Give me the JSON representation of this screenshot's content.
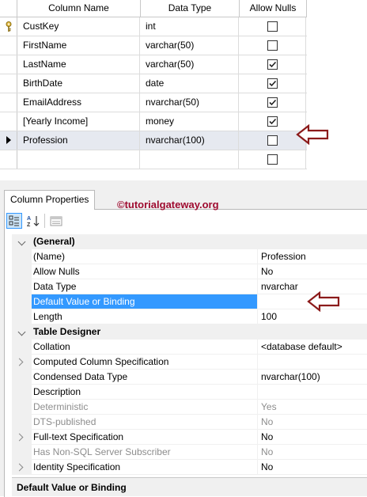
{
  "grid": {
    "headers": {
      "column_name": "Column Name",
      "data_type": "Data Type",
      "allow_nulls": "Allow Nulls"
    },
    "rows": [
      {
        "name": "CustKey",
        "type": "int",
        "allow_nulls": false,
        "primary_key": true,
        "current": false
      },
      {
        "name": "FirstName",
        "type": "varchar(50)",
        "allow_nulls": false,
        "primary_key": false,
        "current": false
      },
      {
        "name": "LastName",
        "type": "varchar(50)",
        "allow_nulls": true,
        "primary_key": false,
        "current": false
      },
      {
        "name": "BirthDate",
        "type": "date",
        "allow_nulls": true,
        "primary_key": false,
        "current": false
      },
      {
        "name": "EmailAddress",
        "type": "nvarchar(50)",
        "allow_nulls": true,
        "primary_key": false,
        "current": false
      },
      {
        "name": "[Yearly Income]",
        "type": "money",
        "allow_nulls": true,
        "primary_key": false,
        "current": false
      },
      {
        "name": "Profession",
        "type": "nvarchar(100)",
        "allow_nulls": false,
        "primary_key": false,
        "current": true
      },
      {
        "name": "",
        "type": "",
        "allow_nulls": false,
        "primary_key": false,
        "current": false
      }
    ]
  },
  "panel": {
    "tab_label": "Column Properties",
    "watermark": "©tutorialgateway.org"
  },
  "properties": {
    "general": {
      "label": "(General)",
      "name_label": "(Name)",
      "name_value": "Profession",
      "allow_nulls_label": "Allow Nulls",
      "allow_nulls_value": "No",
      "data_type_label": "Data Type",
      "data_type_value": "nvarchar",
      "default_label": "Default Value or Binding",
      "default_value": "",
      "length_label": "Length",
      "length_value": "100"
    },
    "table_designer": {
      "label": "Table Designer",
      "collation_label": "Collation",
      "collation_value": "<database default>",
      "computed_label": "Computed Column Specification",
      "computed_value": "",
      "condensed_label": "Condensed Data Type",
      "condensed_value": "nvarchar(100)",
      "description_label": "Description",
      "description_value": "",
      "deterministic_label": "Deterministic",
      "deterministic_value": "Yes",
      "dts_label": "DTS-published",
      "dts_value": "No",
      "fulltext_label": "Full-text Specification",
      "fulltext_value": "No",
      "nonsql_label": "Has Non-SQL Server Subscriber",
      "nonsql_value": "No",
      "identity_label": "Identity Specification",
      "identity_value": "No"
    }
  },
  "description_bar": "Default Value or Binding",
  "colors": {
    "selection": "#3399ff",
    "annotation_arrow": "#8b1a1a",
    "watermark": "#9e0b2f"
  }
}
